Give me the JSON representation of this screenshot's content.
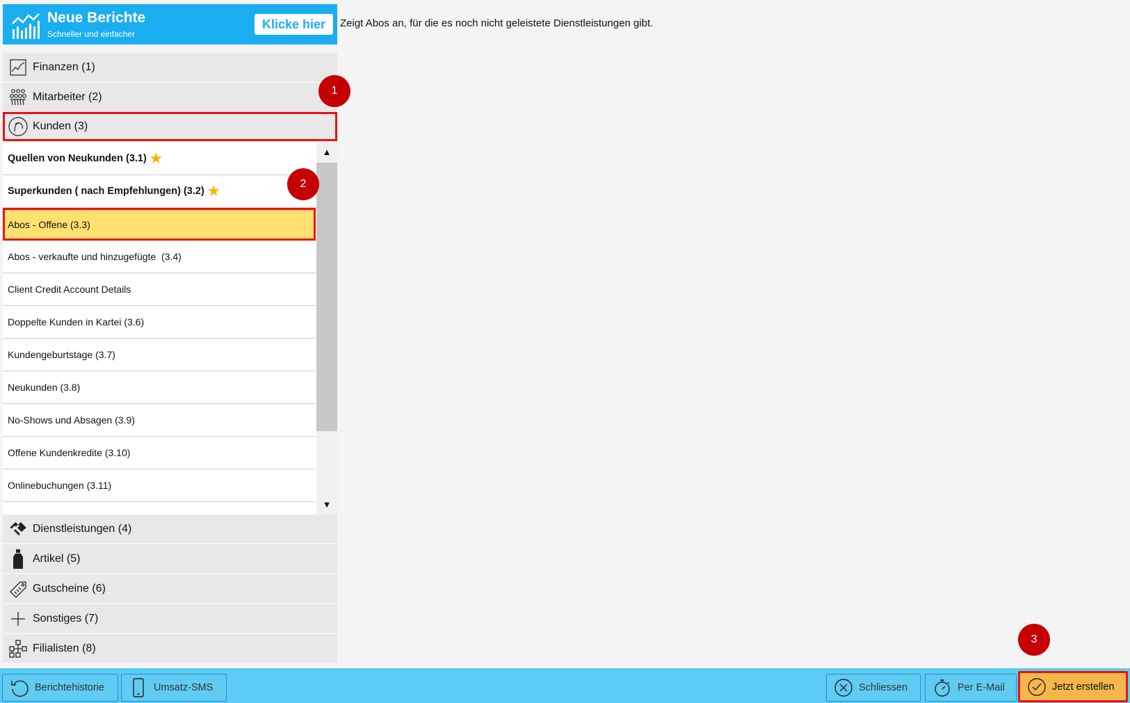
{
  "banner": {
    "title": "Neue Berichte",
    "subtitle": "Schneller und einfacher",
    "button_label": "Klicke hier"
  },
  "description": "Zeigt Abos an, für die es noch nicht geleistete Dienstleistungen gibt.",
  "categories": [
    {
      "label": "Finanzen (1)",
      "icon": "chart-icon"
    },
    {
      "label": "Mitarbeiter (2)",
      "icon": "staff-icon"
    },
    {
      "label": "Kunden (3)",
      "icon": "customer-icon"
    },
    {
      "label": "Dienstleistungen (4)",
      "icon": "handshake-icon"
    },
    {
      "label": "Artikel (5)",
      "icon": "bottle-icon"
    },
    {
      "label": "Gutscheine (6)",
      "icon": "voucher-icon"
    },
    {
      "label": "Sonstiges (7)",
      "icon": "plus-icon"
    },
    {
      "label": "Filialisten (8)",
      "icon": "network-icon"
    }
  ],
  "reports": [
    {
      "label": "Quellen von Neukunden (3.1)",
      "starred": true
    },
    {
      "label": "Superkunden ( nach Empfehlungen) (3.2)",
      "starred": true
    },
    {
      "label": "Abos - Offene (3.3)",
      "selected": true
    },
    {
      "label": "Abos - verkaufte und hinzugefügte  (3.4)"
    },
    {
      "label": "Client Credit Account Details"
    },
    {
      "label": "Doppelte Kunden in Kartei (3.6)"
    },
    {
      "label": "Kundengeburtstage (3.7)"
    },
    {
      "label": "Neukunden (3.8)"
    },
    {
      "label": "No-Shows und Absagen (3.9)"
    },
    {
      "label": "Offene Kundenkredite (3.10)"
    },
    {
      "label": "Onlinebuchungen (3.11)"
    }
  ],
  "star_glyph": "★",
  "scroll": {
    "up": "▲",
    "down": "▼"
  },
  "bottom_buttons": {
    "history": "Berichtehistorie",
    "sms": "Umsatz-SMS",
    "close": "Schliessen",
    "email": "Per E-Mail",
    "create": "Jetzt erstellen"
  },
  "badges": [
    "1",
    "2",
    "3"
  ],
  "colors": {
    "accent": "#1aaef0",
    "bottombar": "#5ccbf5",
    "highlight": "#ee1111",
    "selected_row": "#ffe070",
    "primary_button": "#f5b74a",
    "badge": "#c40000"
  }
}
